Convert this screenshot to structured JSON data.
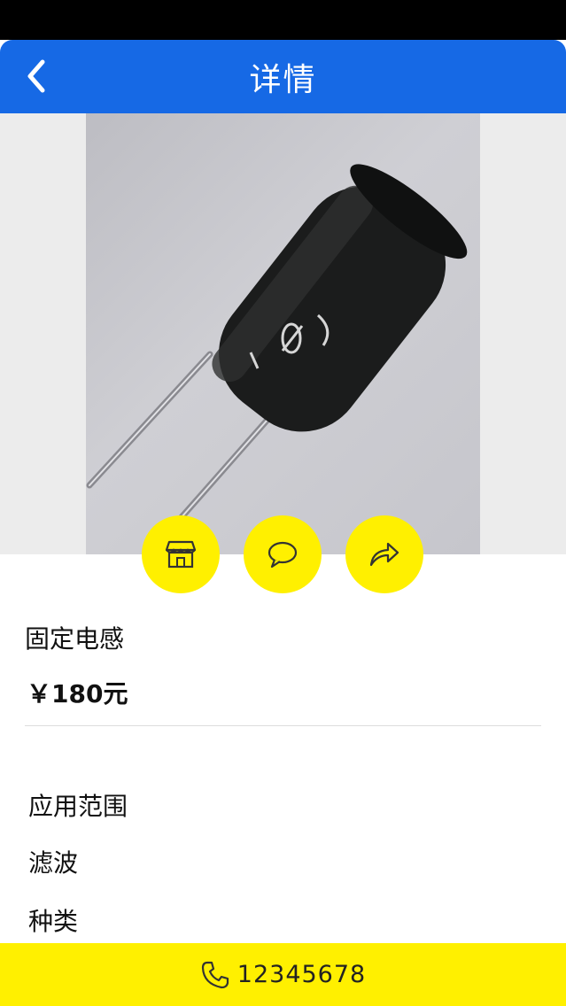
{
  "header": {
    "title": "详情",
    "back_icon": "chevron-left-icon"
  },
  "product": {
    "name": "固定电感",
    "price": "￥180元"
  },
  "actions": [
    {
      "icon": "store-icon"
    },
    {
      "icon": "chat-bubble-icon"
    },
    {
      "icon": "share-arrow-icon"
    }
  ],
  "specs": {
    "label_application": "应用范围",
    "value_application": "滤波",
    "label_type": "种类"
  },
  "footer": {
    "phone_icon": "phone-icon",
    "phone_number": "12345678"
  },
  "colors": {
    "header_bg": "#1669e5",
    "accent_yellow": "#fff000",
    "status_bar": "#000000"
  }
}
